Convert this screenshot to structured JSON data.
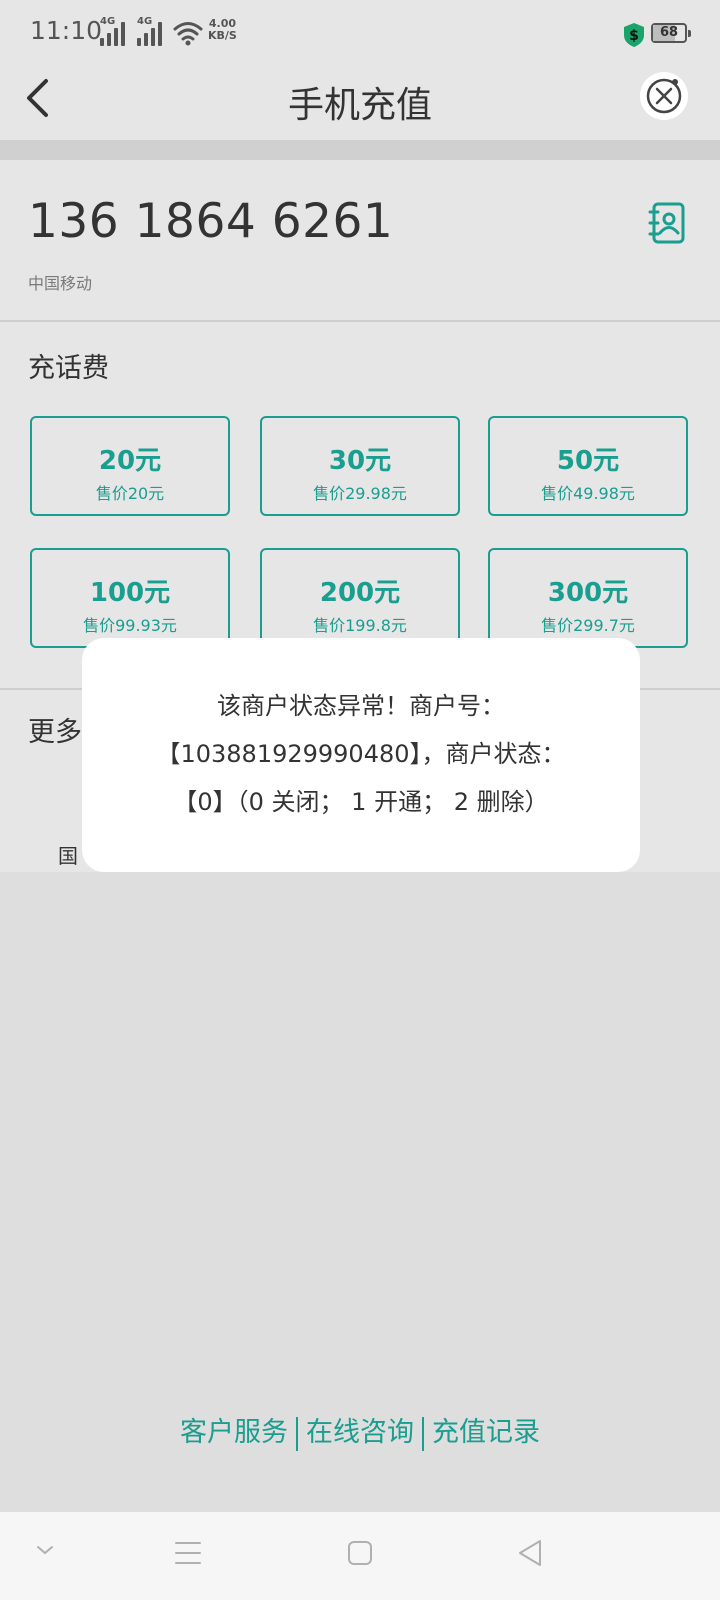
{
  "status_bar": {
    "time": "11:10",
    "network_tag_1": "4G",
    "network_tag_2": "4G",
    "speed_value": "4.00",
    "speed_unit": "KB/S",
    "battery_level": "68",
    "battery_fraction": 0.68
  },
  "header": {
    "title": "手机充值"
  },
  "phone": {
    "number": "136 1864 6261",
    "carrier": "中国移动"
  },
  "recharge": {
    "title": "充话费",
    "options": [
      {
        "amount": "20元",
        "price": "售价20元"
      },
      {
        "amount": "30元",
        "price": "售价29.98元"
      },
      {
        "amount": "50元",
        "price": "售价49.98元"
      },
      {
        "amount": "100元",
        "price": "售价99.93元"
      },
      {
        "amount": "200元",
        "price": "售价199.8元"
      },
      {
        "amount": "300元",
        "price": "售价299.7元"
      }
    ]
  },
  "more": {
    "title_partial": "更多",
    "intl_partial": "国",
    "intl_right_partial": "："
  },
  "dialog": {
    "line1": "该商户状态异常！商户号：",
    "line2": "【103881929990480】，商户状态：",
    "line3": "【0】（0 关闭； 1 开通； 2 删除）"
  },
  "footer": {
    "links": [
      "客户服务",
      "在线咨询",
      "充值记录"
    ]
  },
  "colors": {
    "accent": "#1a9e8f"
  }
}
